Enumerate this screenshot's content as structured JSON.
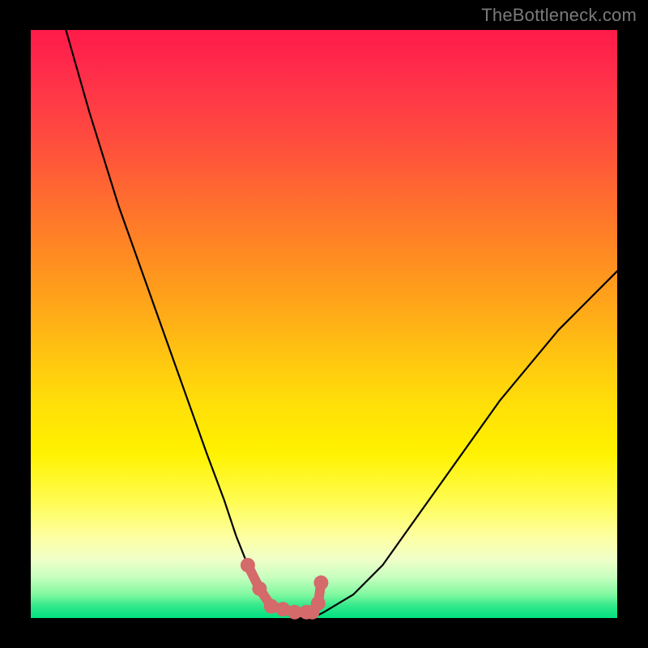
{
  "attribution": "TheBottleneck.com",
  "chart_data": {
    "type": "line",
    "title": "",
    "xlabel": "",
    "ylabel": "",
    "xlim": [
      0,
      100
    ],
    "ylim": [
      0,
      100
    ],
    "grid": false,
    "x": [
      6,
      10,
      15,
      20,
      25,
      30,
      33,
      35,
      37,
      40,
      43,
      46,
      48,
      50,
      55,
      60,
      65,
      70,
      75,
      80,
      85,
      90,
      95,
      100
    ],
    "values": [
      100,
      86,
      70,
      56,
      42,
      28,
      20,
      14,
      9,
      4,
      1,
      0,
      0,
      1,
      4,
      9,
      16,
      23,
      30,
      37,
      43,
      49,
      54,
      59
    ],
    "overlay_markers": {
      "color": "#d46a6a",
      "points": [
        {
          "x": 37,
          "y": 9
        },
        {
          "x": 39,
          "y": 5
        },
        {
          "x": 41,
          "y": 2
        },
        {
          "x": 43,
          "y": 1.5
        },
        {
          "x": 45,
          "y": 1
        },
        {
          "x": 47,
          "y": 1
        },
        {
          "x": 48,
          "y": 1
        },
        {
          "x": 49,
          "y": 2.5
        },
        {
          "x": 49.5,
          "y": 6
        }
      ]
    }
  }
}
